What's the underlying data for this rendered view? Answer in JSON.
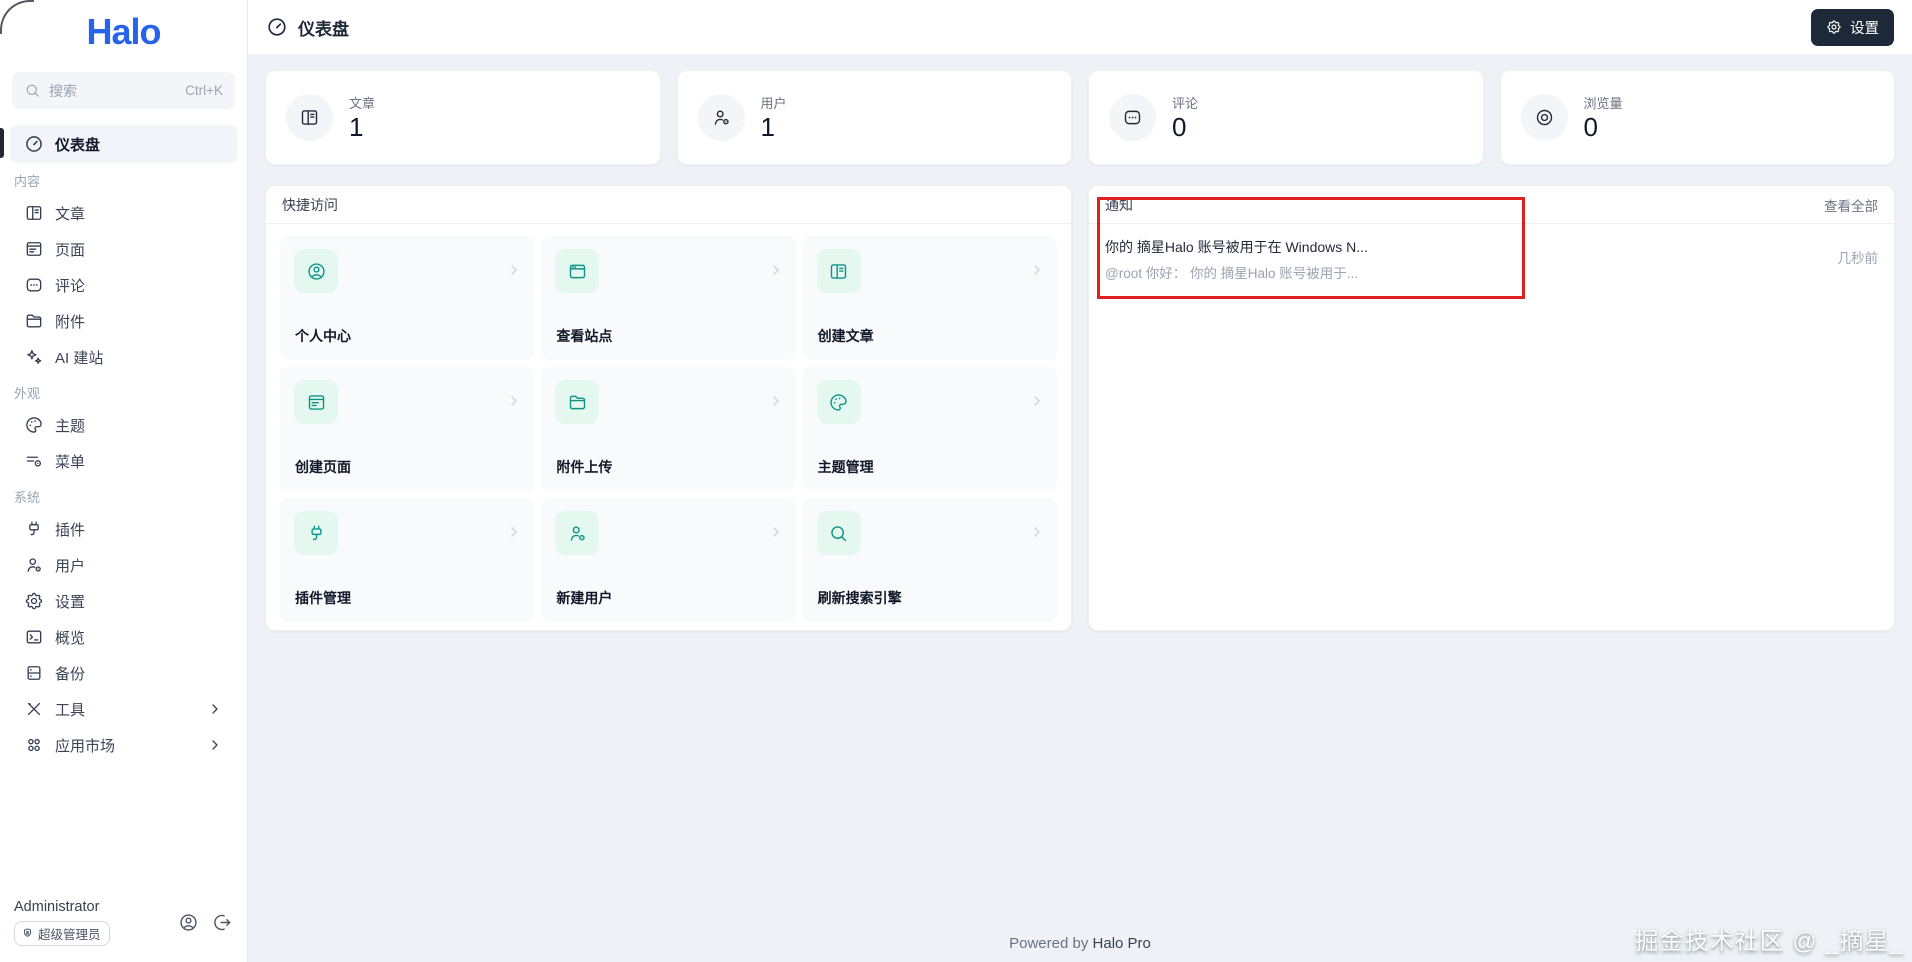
{
  "colors": {
    "accent_blue": "#2563eb",
    "teal": "#0d9488",
    "mint_badge_bg": "#e4f8f0",
    "dark_button_bg": "#1d2939",
    "annotation_red": "#e02020",
    "page_bg": "#eef2f6",
    "active_indicator": "#25282c"
  },
  "sidebar": {
    "logo": "Halo",
    "search": {
      "placeholder": "搜索",
      "shortcut": "Ctrl+K"
    },
    "sections": [
      {
        "label": "",
        "items": [
          {
            "label": "仪表盘",
            "icon": "gauge-icon"
          }
        ]
      },
      {
        "label": "内容",
        "items": [
          {
            "label": "文章",
            "icon": "posts-icon"
          },
          {
            "label": "页面",
            "icon": "pages-icon"
          },
          {
            "label": "评论",
            "icon": "comments-icon"
          },
          {
            "label": "附件",
            "icon": "folder-icon"
          },
          {
            "label": "AI 建站",
            "icon": "sparkles-icon"
          }
        ]
      },
      {
        "label": "外观",
        "items": [
          {
            "label": "主题",
            "icon": "palette-icon"
          },
          {
            "label": "菜单",
            "icon": "menu-settings-icon"
          }
        ]
      },
      {
        "label": "系统",
        "items": [
          {
            "label": "插件",
            "icon": "plug-icon"
          },
          {
            "label": "用户",
            "icon": "user-gear-icon"
          },
          {
            "label": "设置",
            "icon": "gear-icon"
          },
          {
            "label": "概览",
            "icon": "terminal-icon"
          },
          {
            "label": "备份",
            "icon": "server-icon"
          },
          {
            "label": "工具",
            "icon": "tools-icon"
          },
          {
            "label": "应用市场",
            "icon": "grid-icon"
          }
        ]
      }
    ],
    "user": {
      "name": "Administrator",
      "role": "超级管理员"
    }
  },
  "header": {
    "title": "仪表盘",
    "settings_button": "设置"
  },
  "stats": [
    {
      "label": "文章",
      "value": "1",
      "icon": "posts-icon"
    },
    {
      "label": "用户",
      "value": "1",
      "icon": "user-gear-icon"
    },
    {
      "label": "评论",
      "value": "0",
      "icon": "comments-icon"
    },
    {
      "label": "浏览量",
      "value": "0",
      "icon": "views-icon"
    }
  ],
  "quick_access": {
    "title": "快捷访问",
    "tiles": [
      {
        "label": "个人中心",
        "icon": "user-circle-icon"
      },
      {
        "label": "查看站点",
        "icon": "browser-icon"
      },
      {
        "label": "创建文章",
        "icon": "posts-icon"
      },
      {
        "label": "创建页面",
        "icon": "pages-icon"
      },
      {
        "label": "附件上传",
        "icon": "folder-icon"
      },
      {
        "label": "主题管理",
        "icon": "palette-icon"
      },
      {
        "label": "插件管理",
        "icon": "plug-icon"
      },
      {
        "label": "新建用户",
        "icon": "user-gear-icon"
      },
      {
        "label": "刷新搜索引擎",
        "icon": "search-icon"
      }
    ]
  },
  "notifications": {
    "title": "通知",
    "view_all": "查看全部",
    "items": [
      {
        "title": "你的 摘星Halo 账号被用于在 Windows N...",
        "description": "@root 你好： 你的 摘星Halo 账号被用于...",
        "time": "几秒前"
      }
    ]
  },
  "footer": {
    "powered_by": "Powered by",
    "product": "Halo Pro"
  },
  "watermark": "掘金技术社区 @ _摘星_"
}
